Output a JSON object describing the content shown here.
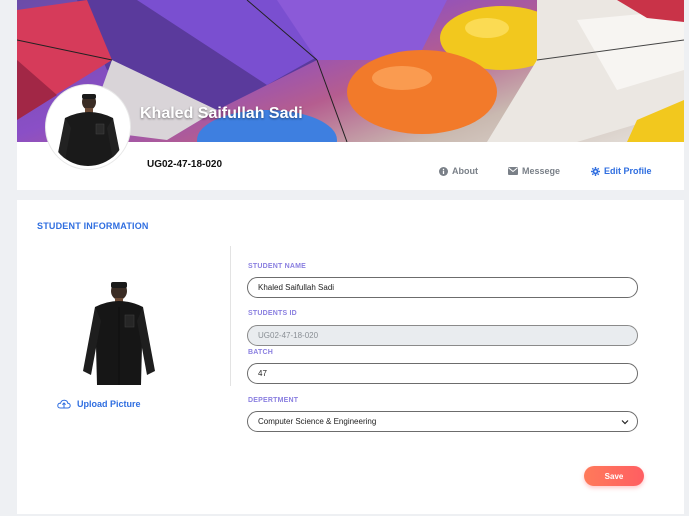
{
  "profile": {
    "name": "Khaled Saifullah Sadi",
    "student_id": "UG02-47-18-020"
  },
  "nav": {
    "about": "About",
    "message": "Messege",
    "edit_profile": "Edit Profile"
  },
  "student_info": {
    "title": "STUDENT INFORMATION",
    "upload_label": "Upload Picture",
    "fields": {
      "name_label": "STUDENT NAME",
      "name_value": "Khaled Saifullah Sadi",
      "id_label": "STUDENTS ID",
      "id_value": "UG02-47-18-020",
      "batch_label": "BATCH",
      "batch_value": "47",
      "department_label": "DEPERTMENT",
      "department_value": "Computer Science & Engineering"
    },
    "save_label": "Save"
  },
  "colors": {
    "accent": "#2f6ee0",
    "field_label": "#8a7fe0",
    "save_gradient_start": "#ff7a5a",
    "save_gradient_end": "#ff5e62"
  },
  "icons": {
    "about": "info-circle-icon",
    "message": "envelope-icon",
    "edit_profile": "gear-icon",
    "upload": "cloud-upload-icon",
    "department_select": "chevron-down-icon"
  }
}
